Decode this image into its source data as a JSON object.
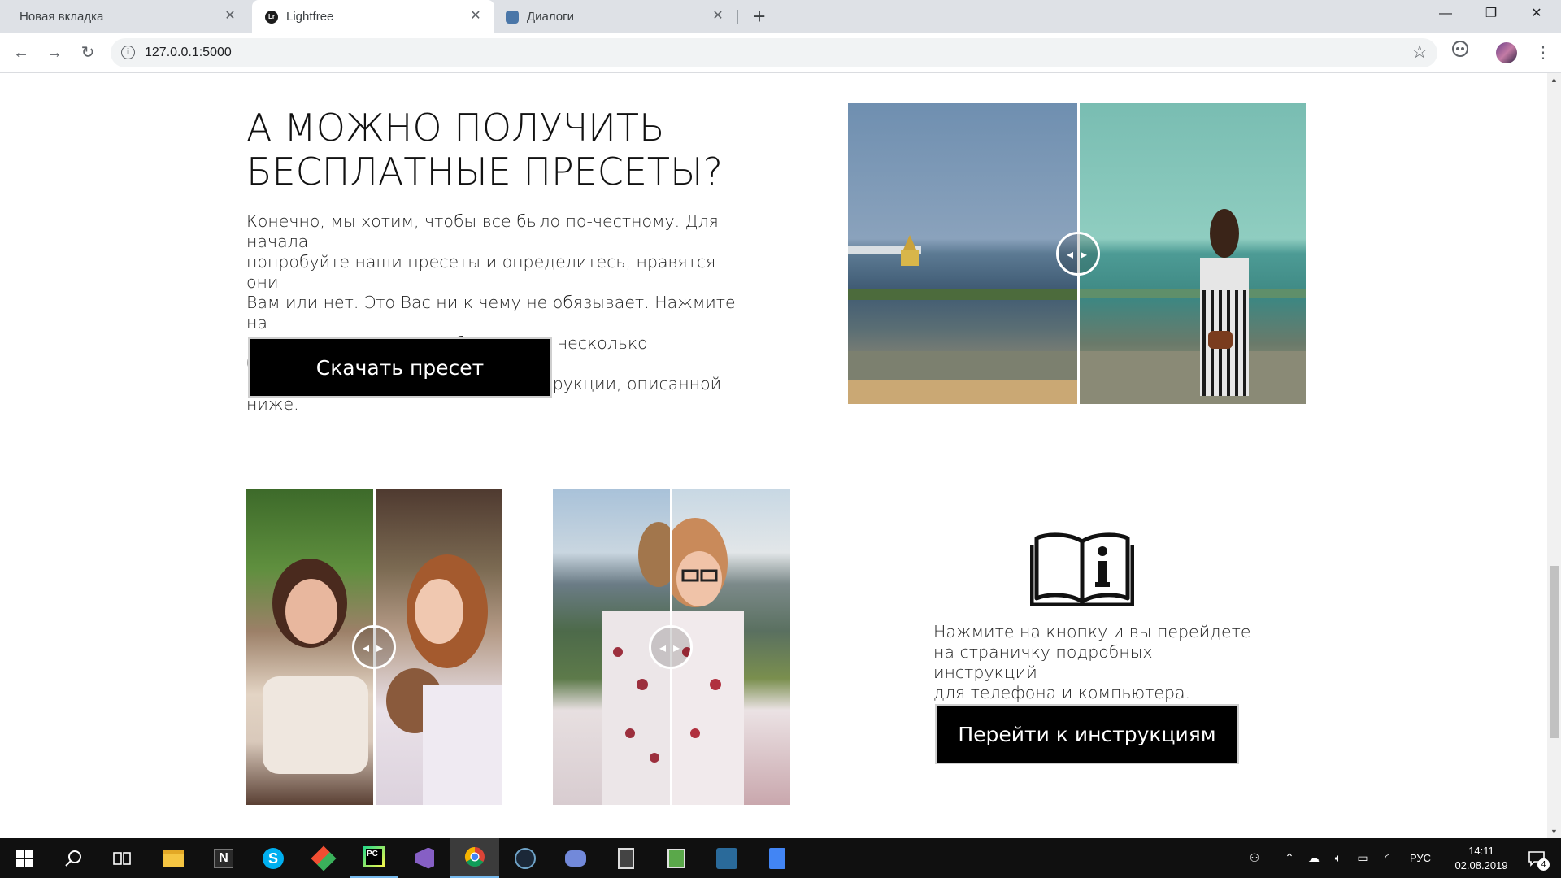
{
  "browser": {
    "tabs": [
      {
        "label": "Новая вкладка",
        "active": false
      },
      {
        "label": "Lightfree",
        "active": true,
        "favicon_text": "Lr"
      },
      {
        "label": "Диалоги",
        "active": false
      }
    ],
    "url": "127.0.0.1:5000"
  },
  "section1": {
    "heading_line1": "А МОЖНО ПОЛУЧИТЬ",
    "heading_line2": "БЕСПЛАТНЫЕ ПРЕСЕТЫ?",
    "paragraph_lines": [
      "Конечно, мы хотим, чтобы все было по-честному. Для начала",
      "попробуйте наши пресеты и определитесь, нравятся они",
      "Вам или нет. Это Вас ни к чему не обязывает. Нажмите на",
      "кнопку скачивания, чтобы скачать несколько бесплатных",
      "пресетов, а дальше следуйте инструкции, описанной ниже."
    ],
    "download_button": "Скачать пресет"
  },
  "section2": {
    "instructions_lines": [
      "Нажмите на кнопку и вы перейдете",
      "на страничку подробных инструкций",
      "для телефона и компьютера."
    ],
    "instructions_button": "Перейти к инструкциям"
  },
  "taskbar": {
    "time": "14:11",
    "date": "02.08.2019",
    "language": "РУС",
    "notifications": "4"
  }
}
